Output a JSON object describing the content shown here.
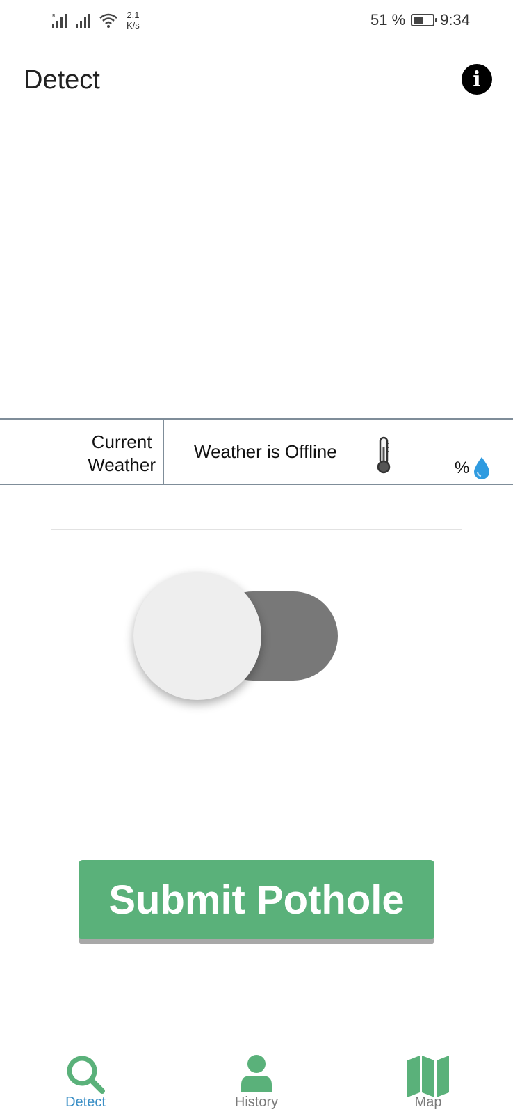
{
  "status_bar": {
    "speed_value": "2.1",
    "speed_unit": "K/s",
    "battery_percent": "51 %",
    "battery_level": 0.51,
    "time": "9:34"
  },
  "app_bar": {
    "title": "Detect",
    "info_icon": "info-circle-icon"
  },
  "weather": {
    "label_line1": "Current",
    "label_line2": "Weather",
    "status": "Weather is Offline",
    "humidity_unit": "%",
    "icons": [
      "thermometer-icon",
      "water-drop-icon"
    ]
  },
  "toggle": {
    "state": "off"
  },
  "submit_label": "Submit Pothole",
  "colors": {
    "accent_green": "#5ab17a",
    "active_nav": "#3b8fc6",
    "drop_blue": "#2f9be0"
  },
  "bottom_nav": {
    "items": [
      {
        "label": "Detect",
        "icon": "search-icon",
        "active": true
      },
      {
        "label": "History",
        "icon": "user-icon",
        "active": false
      },
      {
        "label": "Map",
        "icon": "map-icon",
        "active": false
      }
    ]
  }
}
